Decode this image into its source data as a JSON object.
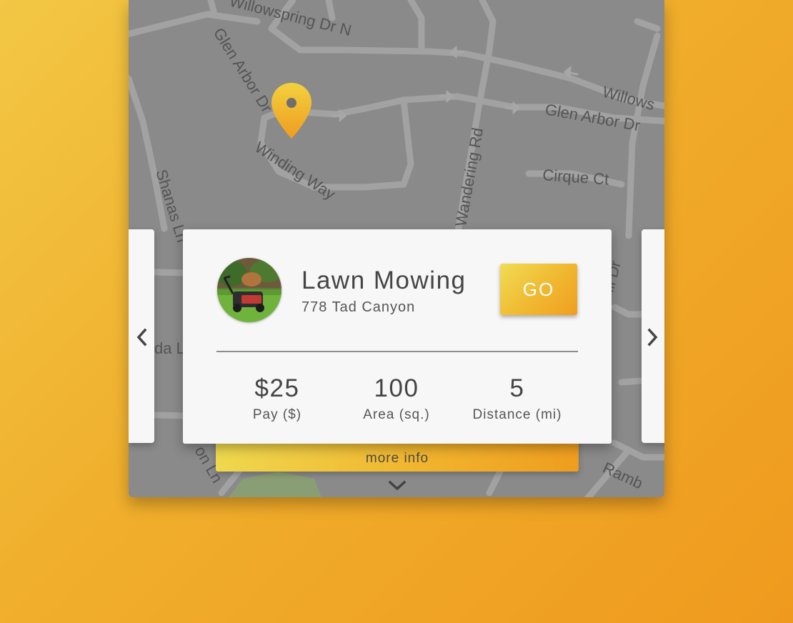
{
  "map": {
    "streets": [
      "Willowspring Dr N",
      "Glen Arbor Dr",
      "Winding Way",
      "Shanas Ln",
      "Wandering Rd",
      "Glen Arbor Dr",
      "Cirque Ct",
      "Willows",
      "ill Dr",
      "da L",
      "on Ln",
      "Ramb"
    ],
    "pin_icon": "map-pin-icon",
    "pin_color": "#f0b42a"
  },
  "card": {
    "title": "Lawn Mowing",
    "address": "778 Tad Canyon",
    "go_label": "GO",
    "stats": [
      {
        "value": "$25",
        "label": "Pay ($)"
      },
      {
        "value": "100",
        "label": "Area (sq.)"
      },
      {
        "value": "5",
        "label": "Distance (mi)"
      }
    ]
  },
  "more_info_label": "more info",
  "icons": {
    "prev": "chevron-left-icon",
    "next": "chevron-right-icon",
    "expand": "chevron-down-icon"
  },
  "colors": {
    "accent_start": "#f0dc54",
    "accent_end": "#ef9a1e",
    "map_bg": "#8a8a8a",
    "card_bg": "#f7f7f7"
  }
}
